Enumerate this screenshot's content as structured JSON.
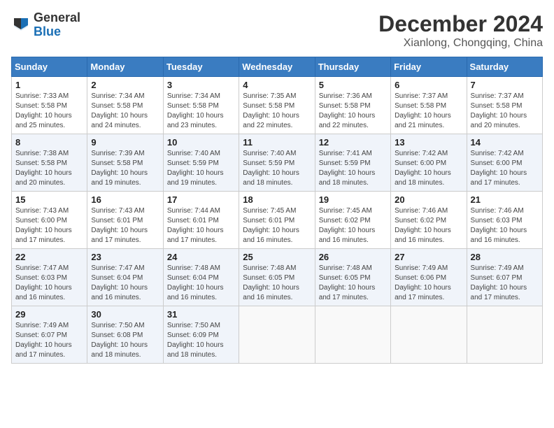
{
  "header": {
    "logo_general": "General",
    "logo_blue": "Blue",
    "month_title": "December 2024",
    "location": "Xianlong, Chongqing, China"
  },
  "weekdays": [
    "Sunday",
    "Monday",
    "Tuesday",
    "Wednesday",
    "Thursday",
    "Friday",
    "Saturday"
  ],
  "weeks": [
    [
      {
        "day": "1",
        "info": "Sunrise: 7:33 AM\nSunset: 5:58 PM\nDaylight: 10 hours\nand 25 minutes."
      },
      {
        "day": "2",
        "info": "Sunrise: 7:34 AM\nSunset: 5:58 PM\nDaylight: 10 hours\nand 24 minutes."
      },
      {
        "day": "3",
        "info": "Sunrise: 7:34 AM\nSunset: 5:58 PM\nDaylight: 10 hours\nand 23 minutes."
      },
      {
        "day": "4",
        "info": "Sunrise: 7:35 AM\nSunset: 5:58 PM\nDaylight: 10 hours\nand 22 minutes."
      },
      {
        "day": "5",
        "info": "Sunrise: 7:36 AM\nSunset: 5:58 PM\nDaylight: 10 hours\nand 22 minutes."
      },
      {
        "day": "6",
        "info": "Sunrise: 7:37 AM\nSunset: 5:58 PM\nDaylight: 10 hours\nand 21 minutes."
      },
      {
        "day": "7",
        "info": "Sunrise: 7:37 AM\nSunset: 5:58 PM\nDaylight: 10 hours\nand 20 minutes."
      }
    ],
    [
      {
        "day": "8",
        "info": "Sunrise: 7:38 AM\nSunset: 5:58 PM\nDaylight: 10 hours\nand 20 minutes."
      },
      {
        "day": "9",
        "info": "Sunrise: 7:39 AM\nSunset: 5:58 PM\nDaylight: 10 hours\nand 19 minutes."
      },
      {
        "day": "10",
        "info": "Sunrise: 7:40 AM\nSunset: 5:59 PM\nDaylight: 10 hours\nand 19 minutes."
      },
      {
        "day": "11",
        "info": "Sunrise: 7:40 AM\nSunset: 5:59 PM\nDaylight: 10 hours\nand 18 minutes."
      },
      {
        "day": "12",
        "info": "Sunrise: 7:41 AM\nSunset: 5:59 PM\nDaylight: 10 hours\nand 18 minutes."
      },
      {
        "day": "13",
        "info": "Sunrise: 7:42 AM\nSunset: 6:00 PM\nDaylight: 10 hours\nand 18 minutes."
      },
      {
        "day": "14",
        "info": "Sunrise: 7:42 AM\nSunset: 6:00 PM\nDaylight: 10 hours\nand 17 minutes."
      }
    ],
    [
      {
        "day": "15",
        "info": "Sunrise: 7:43 AM\nSunset: 6:00 PM\nDaylight: 10 hours\nand 17 minutes."
      },
      {
        "day": "16",
        "info": "Sunrise: 7:43 AM\nSunset: 6:01 PM\nDaylight: 10 hours\nand 17 minutes."
      },
      {
        "day": "17",
        "info": "Sunrise: 7:44 AM\nSunset: 6:01 PM\nDaylight: 10 hours\nand 17 minutes."
      },
      {
        "day": "18",
        "info": "Sunrise: 7:45 AM\nSunset: 6:01 PM\nDaylight: 10 hours\nand 16 minutes."
      },
      {
        "day": "19",
        "info": "Sunrise: 7:45 AM\nSunset: 6:02 PM\nDaylight: 10 hours\nand 16 minutes."
      },
      {
        "day": "20",
        "info": "Sunrise: 7:46 AM\nSunset: 6:02 PM\nDaylight: 10 hours\nand 16 minutes."
      },
      {
        "day": "21",
        "info": "Sunrise: 7:46 AM\nSunset: 6:03 PM\nDaylight: 10 hours\nand 16 minutes."
      }
    ],
    [
      {
        "day": "22",
        "info": "Sunrise: 7:47 AM\nSunset: 6:03 PM\nDaylight: 10 hours\nand 16 minutes."
      },
      {
        "day": "23",
        "info": "Sunrise: 7:47 AM\nSunset: 6:04 PM\nDaylight: 10 hours\nand 16 minutes."
      },
      {
        "day": "24",
        "info": "Sunrise: 7:48 AM\nSunset: 6:04 PM\nDaylight: 10 hours\nand 16 minutes."
      },
      {
        "day": "25",
        "info": "Sunrise: 7:48 AM\nSunset: 6:05 PM\nDaylight: 10 hours\nand 16 minutes."
      },
      {
        "day": "26",
        "info": "Sunrise: 7:48 AM\nSunset: 6:05 PM\nDaylight: 10 hours\nand 17 minutes."
      },
      {
        "day": "27",
        "info": "Sunrise: 7:49 AM\nSunset: 6:06 PM\nDaylight: 10 hours\nand 17 minutes."
      },
      {
        "day": "28",
        "info": "Sunrise: 7:49 AM\nSunset: 6:07 PM\nDaylight: 10 hours\nand 17 minutes."
      }
    ],
    [
      {
        "day": "29",
        "info": "Sunrise: 7:49 AM\nSunset: 6:07 PM\nDaylight: 10 hours\nand 17 minutes."
      },
      {
        "day": "30",
        "info": "Sunrise: 7:50 AM\nSunset: 6:08 PM\nDaylight: 10 hours\nand 18 minutes."
      },
      {
        "day": "31",
        "info": "Sunrise: 7:50 AM\nSunset: 6:09 PM\nDaylight: 10 hours\nand 18 minutes."
      },
      null,
      null,
      null,
      null
    ]
  ]
}
